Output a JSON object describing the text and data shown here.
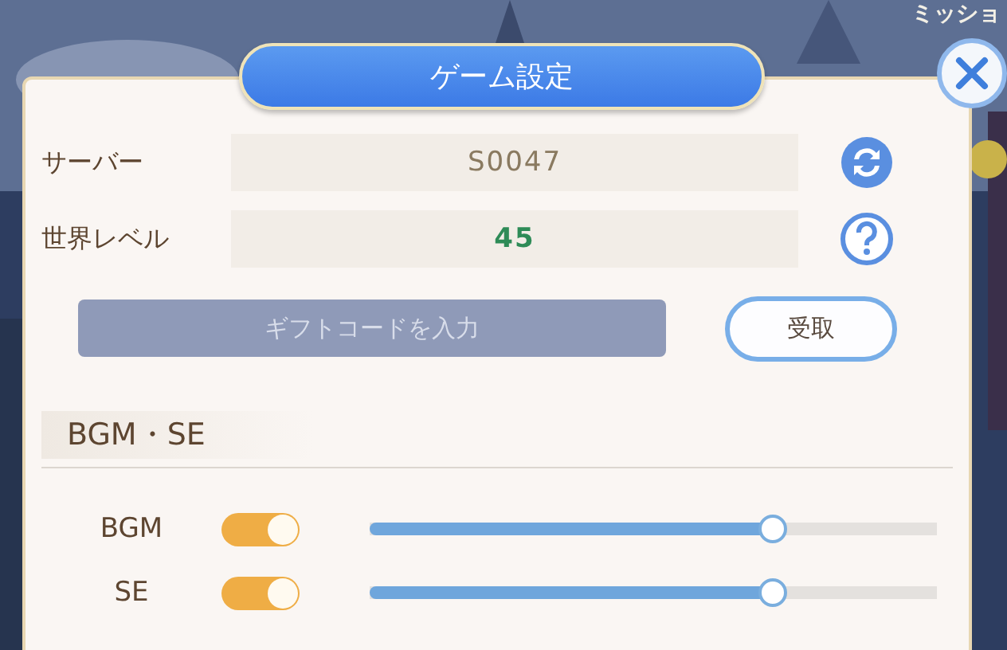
{
  "corner_label": "ミッショ",
  "dialog": {
    "title": "ゲーム設定",
    "rows": [
      {
        "label": "サーバー",
        "value": "S0047",
        "kind": "server"
      },
      {
        "label": "世界レベル",
        "value": "45",
        "kind": "level"
      }
    ],
    "gift_code": {
      "placeholder": "ギフトコードを入力",
      "button": "受取"
    },
    "section": {
      "title": "BGM・SE"
    },
    "audio": [
      {
        "label": "BGM",
        "on": true,
        "level": 0.71
      },
      {
        "label": "SE",
        "on": true,
        "level": 0.71
      }
    ]
  }
}
